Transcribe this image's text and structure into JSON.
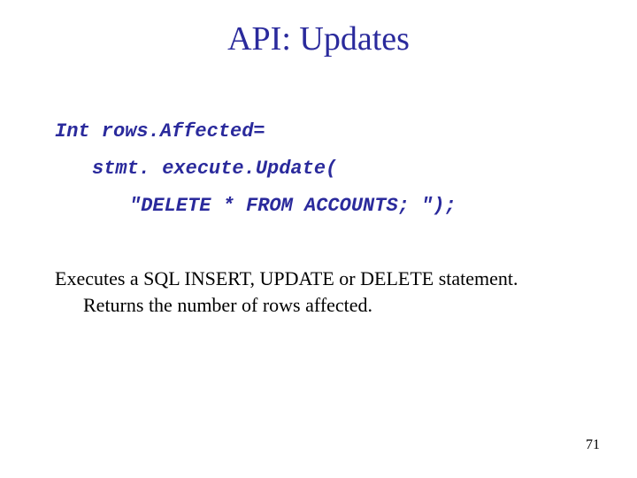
{
  "title": "API: Updates",
  "code": {
    "line1": "Int rows.Affected=",
    "line2": "stmt. execute.Update(",
    "line3": "\"DELETE * FROM ACCOUNTS; \");"
  },
  "body": {
    "line1": "Executes a SQL INSERT, UPDATE or DELETE statement.",
    "line2": "Returns the number of rows affected."
  },
  "page_number": "71"
}
